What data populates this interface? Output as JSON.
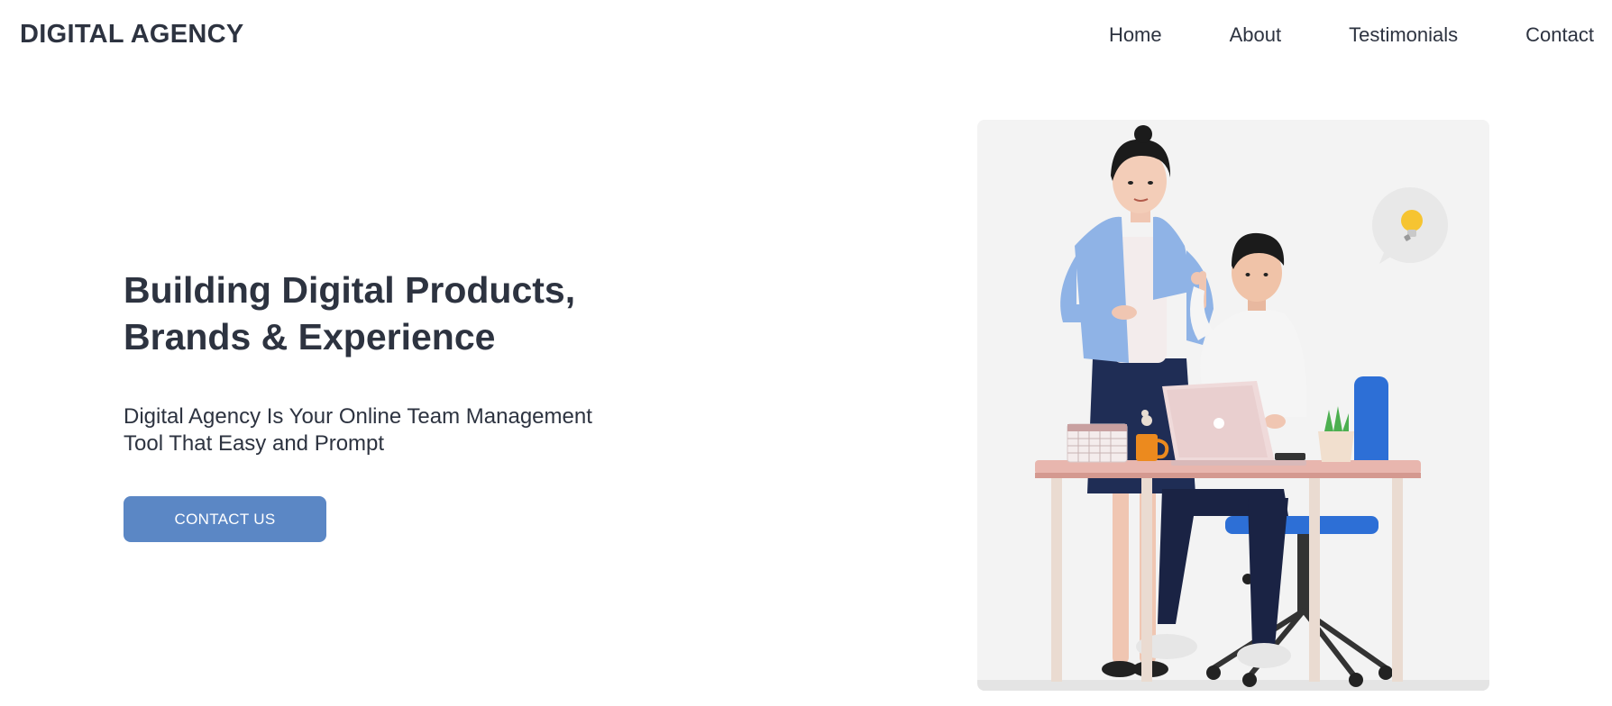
{
  "header": {
    "logo": "DIGITAL AGENCY",
    "nav": [
      {
        "label": "Home"
      },
      {
        "label": "About"
      },
      {
        "label": "Testimonials"
      },
      {
        "label": "Contact"
      }
    ]
  },
  "hero": {
    "title_line1": "Building Digital Products,",
    "title_line2": "Brands & Experience",
    "subtitle_line1": "Digital Agency Is Your Online Team Management",
    "subtitle_line2": "Tool That Easy and Prompt",
    "cta_label": "CONTACT US"
  },
  "illustration": {
    "description_icon": "team-working-at-desk-illustration",
    "accent_color": "#5b87c5",
    "background_color": "#f3f3f3"
  }
}
